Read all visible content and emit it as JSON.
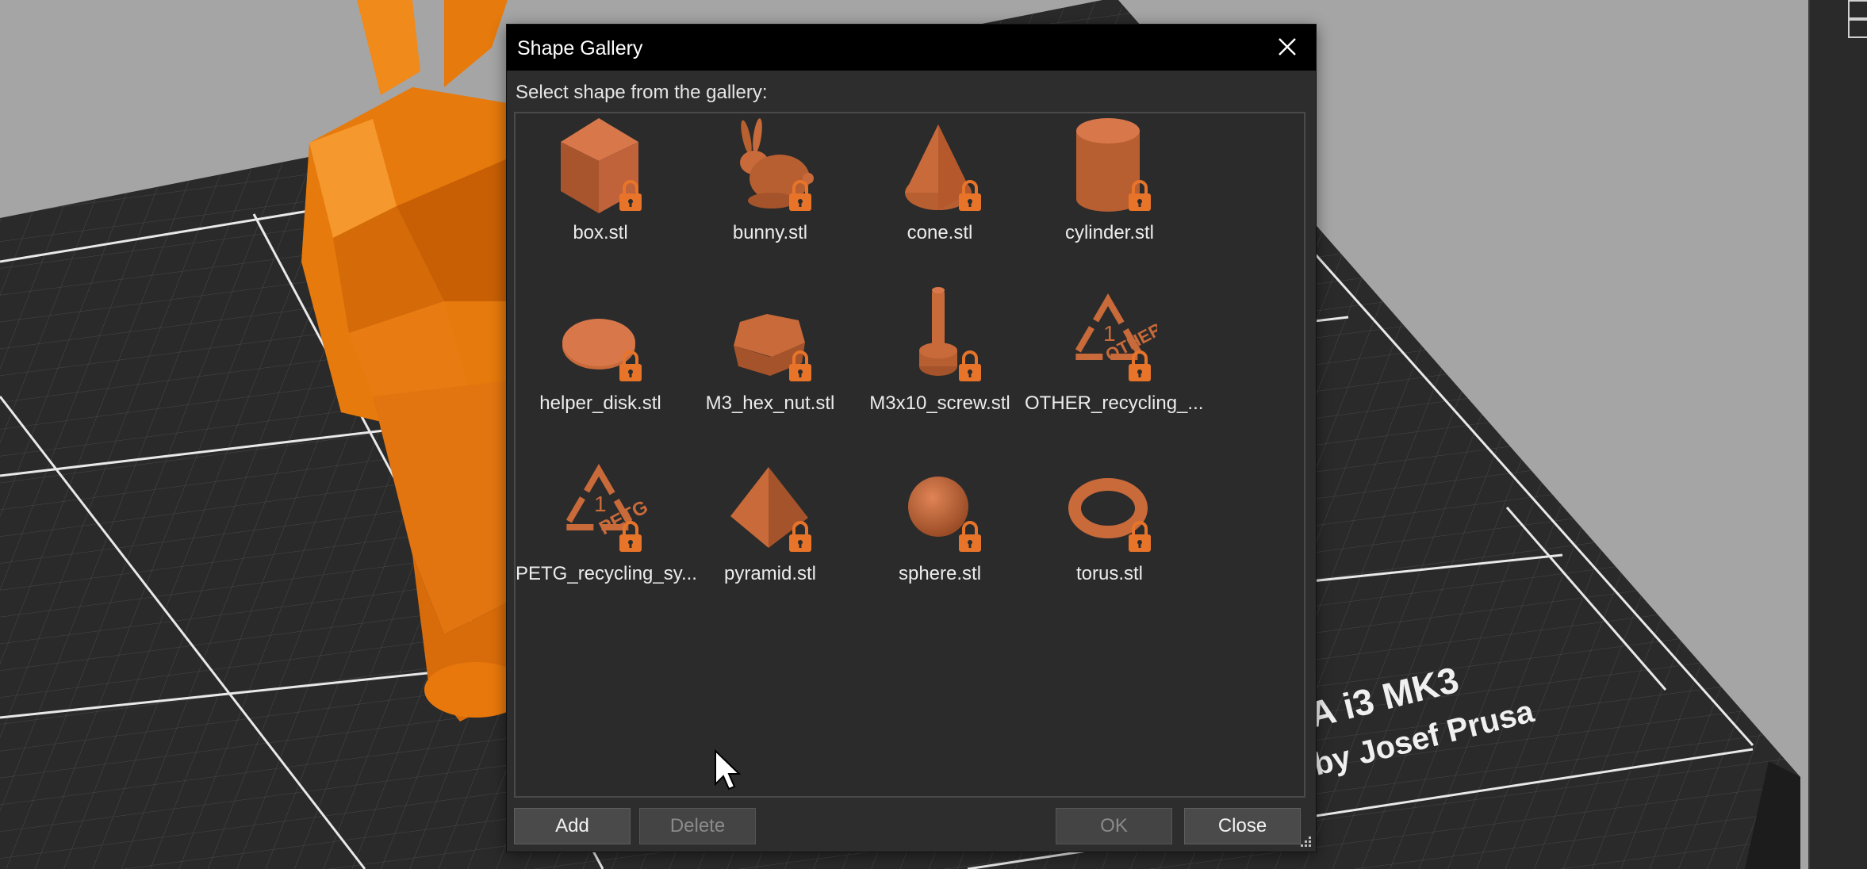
{
  "dialog": {
    "title": "Shape Gallery",
    "prompt": "Select shape from the gallery:",
    "close_icon": "close-icon"
  },
  "shapes": [
    {
      "name": "box.stl",
      "icon": "box-shape-icon"
    },
    {
      "name": "bunny.stl",
      "icon": "bunny-shape-icon"
    },
    {
      "name": "cone.stl",
      "icon": "cone-shape-icon"
    },
    {
      "name": "cylinder.stl",
      "icon": "cylinder-shape-icon"
    },
    {
      "name": "helper_disk.stl",
      "icon": "disk-shape-icon"
    },
    {
      "name": "M3_hex_nut.stl",
      "icon": "hex-nut-shape-icon"
    },
    {
      "name": "M3x10_screw.stl",
      "icon": "screw-shape-icon"
    },
    {
      "name": "OTHER_recycling_...",
      "icon": "other-recycling-symbol-icon"
    },
    {
      "name": "PETG_recycling_sy...",
      "icon": "petg-recycling-symbol-icon"
    },
    {
      "name": "pyramid.stl",
      "icon": "pyramid-shape-icon"
    },
    {
      "name": "sphere.stl",
      "icon": "sphere-shape-icon"
    },
    {
      "name": "torus.stl",
      "icon": "torus-shape-icon"
    }
  ],
  "buttons": {
    "add": "Add",
    "delete": "Delete",
    "ok": "OK",
    "close": "Close"
  },
  "bed_text": {
    "line1": "A i3  MK3",
    "line2": "by Josef Prusa"
  },
  "colors": {
    "shape": "#c8683a",
    "lock": "#e8742a",
    "model": "#e8780c",
    "dialog_bg": "#2d2d2d",
    "titlebar": "#000000"
  }
}
